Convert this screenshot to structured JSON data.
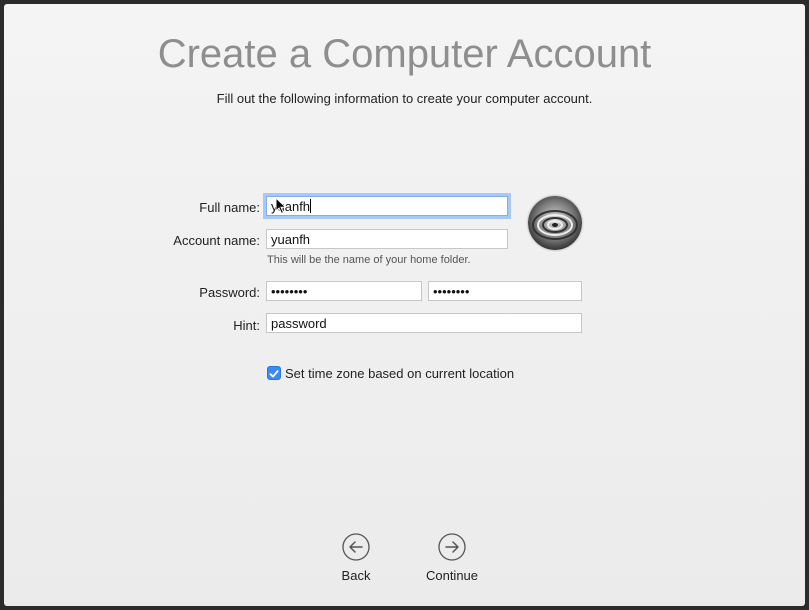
{
  "header": {
    "title": "Create a Computer Account",
    "subtitle": "Fill out the following information to create your computer account."
  },
  "form": {
    "full_name": {
      "label": "Full name:",
      "value": "yuanfh"
    },
    "account_name": {
      "label": "Account name:",
      "value": "yuanfh",
      "help": "This will be the name of your home folder."
    },
    "password": {
      "label": "Password:",
      "value": "••••••••",
      "verify_value": "••••••••"
    },
    "hint": {
      "label": "Hint:",
      "value": "password"
    },
    "timezone": {
      "label": "Set time zone based on current location",
      "checked": true
    }
  },
  "avatar": {
    "icon": "user-picture-spiral"
  },
  "nav": {
    "back_label": "Back",
    "continue_label": "Continue"
  },
  "colors": {
    "accent": "#3a8bf6",
    "title": "#8e8e8e",
    "focus_ring": "#a9c9f5"
  }
}
